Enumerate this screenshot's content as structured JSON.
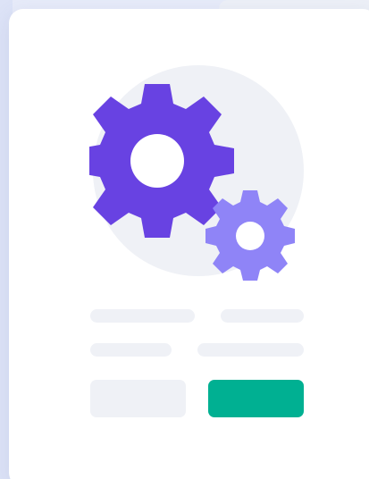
{
  "illustration": {
    "large_gear_icon": "gear-icon",
    "small_gear_icon": "gear-icon"
  },
  "colors": {
    "large_gear": "#6842e2",
    "small_gear": "#8f84f7",
    "circle_backdrop": "#eff1f6",
    "primary_button": "#00b092",
    "skeleton": "#eff1f6"
  },
  "form": {
    "secondary_button_label": "",
    "primary_button_label": ""
  }
}
